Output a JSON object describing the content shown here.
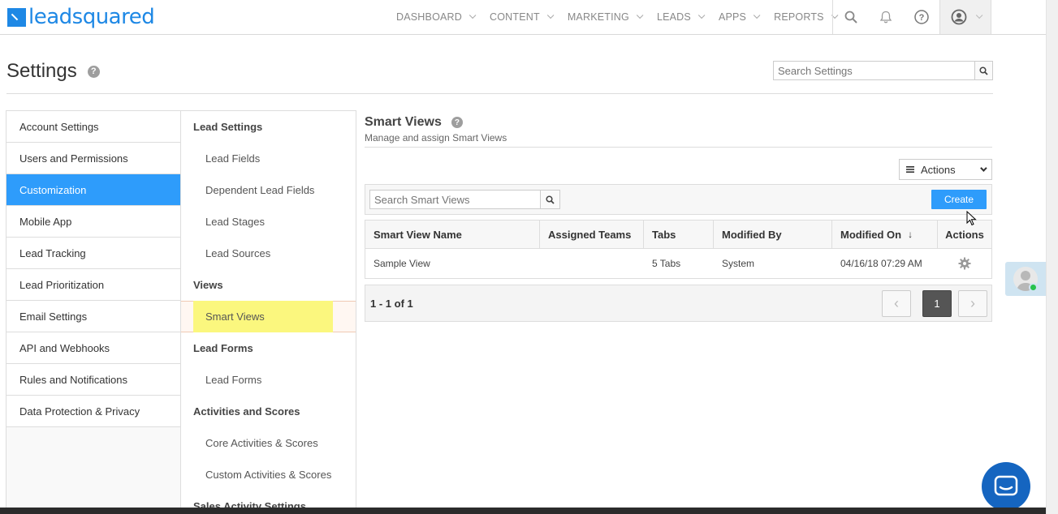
{
  "brand": {
    "logo_text": "leadsquared"
  },
  "nav": {
    "items": [
      {
        "label": "DASHBOARD"
      },
      {
        "label": "CONTENT"
      },
      {
        "label": "MARKETING"
      },
      {
        "label": "LEADS"
      },
      {
        "label": "APPS"
      },
      {
        "label": "REPORTS"
      }
    ],
    "icons": [
      "search-icon",
      "bell-icon",
      "help-icon",
      "user-icon"
    ]
  },
  "header": {
    "title": "Settings",
    "search_placeholder": "Search Settings"
  },
  "left_menu": {
    "items": [
      {
        "label": "Account Settings"
      },
      {
        "label": "Users and Permissions"
      },
      {
        "label": "Customization"
      },
      {
        "label": "Mobile App"
      },
      {
        "label": "Lead Tracking"
      },
      {
        "label": "Lead Prioritization"
      },
      {
        "label": "Email Settings"
      },
      {
        "label": "API and Webhooks"
      },
      {
        "label": "Rules and Notifications"
      },
      {
        "label": "Data Protection & Privacy"
      }
    ],
    "active": "Customization"
  },
  "sub_menu": {
    "sections": [
      {
        "heading": "Lead Settings",
        "items": [
          "Lead Fields",
          "Dependent Lead Fields",
          "Lead Stages",
          "Lead Sources"
        ]
      },
      {
        "heading": "Views",
        "items": [
          "Smart Views"
        ]
      },
      {
        "heading": "Lead Forms",
        "items": [
          "Lead Forms"
        ]
      },
      {
        "heading": "Activities and Scores",
        "items": [
          "Core Activities & Scores",
          "Custom Activities & Scores"
        ]
      },
      {
        "heading": "Sales Activity Settings",
        "items": []
      }
    ],
    "active": "Smart Views"
  },
  "main": {
    "title": "Smart Views",
    "subtitle": "Manage and assign Smart Views",
    "actions_label": "Actions",
    "search_placeholder": "Search Smart Views",
    "create_label": "Create",
    "table": {
      "columns": [
        "Smart View Name",
        "Assigned Teams",
        "Tabs",
        "Modified By",
        "Modified On",
        "Actions"
      ],
      "rows": [
        {
          "name": "Sample View",
          "teams": "",
          "tabs": "5 Tabs",
          "modified_by": "System",
          "modified_on": "04/16/18 07:29 AM"
        }
      ]
    },
    "pager": {
      "summary": "1 - 1 of 1",
      "current_page": "1"
    }
  },
  "colors": {
    "accent": "#2e9cfb",
    "brand": "#1e88e5",
    "highlight": "#fbf77e",
    "chat": "#1565c0"
  }
}
